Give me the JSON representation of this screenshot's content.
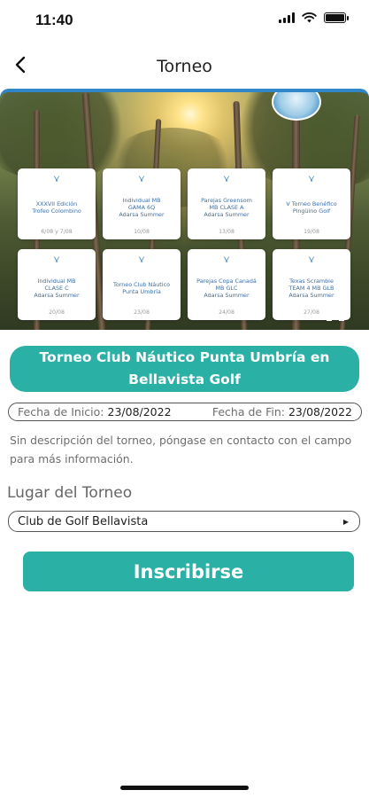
{
  "status_bar": {
    "time": "11:40"
  },
  "nav": {
    "title": "Torneo"
  },
  "banner": {
    "tournaments": [
      {
        "name": "XXXVII Edición\nTrofeo Colombino",
        "date": "6/08 y 7/08"
      },
      {
        "name": "Individual MB\nGAMA 6Q\nAdarsa Summer",
        "date": "10/08"
      },
      {
        "name": "Parejas Greensom\nMB CLASE A\nAdarsa Summer",
        "date": "13/08"
      },
      {
        "name": "V Torneo Benéfico\nPingüino Golf",
        "date": "19/08"
      },
      {
        "name": "Individual MB\nCLASE C\nAdarsa Summer",
        "date": "20/08"
      },
      {
        "name": "Torneo Club Náutico\nPunta Umbría",
        "date": "23/08"
      },
      {
        "name": "Parejas Copa Canadá\nMB GLC\nAdarsa Summer",
        "date": "24/08"
      },
      {
        "name": "Texas Scramble\nTEAM 4 MB GLB\nAdarsa Summer",
        "date": "27/08"
      }
    ]
  },
  "tournament": {
    "title": "Torneo Club Náutico Punta Umbría en Bellavista Golf",
    "start_label": "Fecha de Inicio:",
    "start_date": "23/08/2022",
    "end_label": "Fecha de Fin:",
    "end_date": "23/08/2022",
    "description": "Sin descripción del torneo, póngase en contacto con el campo para más información."
  },
  "location": {
    "heading": "Lugar del Torneo",
    "selected": "Club de Golf Bellavista"
  },
  "actions": {
    "signup_label": "Inscribirse"
  },
  "colors": {
    "accent": "#2bb0a6",
    "banner_border": "#2f86c8",
    "card_text": "#3d6fa7"
  },
  "icons": [
    "back-arrow-icon",
    "signal-icon",
    "wifi-icon",
    "battery-icon",
    "golf-logo-icon",
    "expand-icon",
    "dropdown-arrow-icon"
  ]
}
